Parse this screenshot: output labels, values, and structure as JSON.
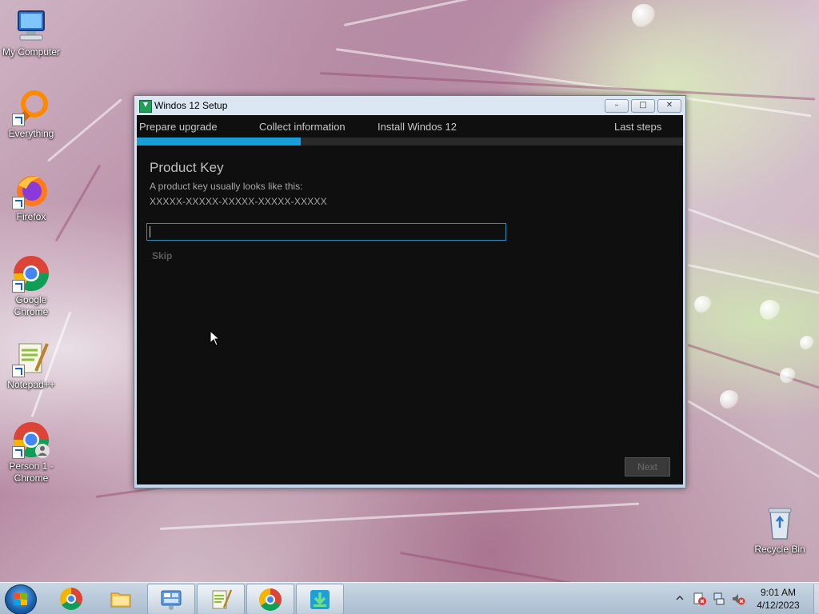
{
  "desktop": {
    "icons": [
      {
        "label": "My Computer",
        "icon": "computer-icon"
      },
      {
        "label": "Everything",
        "icon": "everything-icon"
      },
      {
        "label": "Firefox",
        "icon": "firefox-icon"
      },
      {
        "label": "Google Chrome",
        "icon": "chrome-icon"
      },
      {
        "label": "Notepad++",
        "icon": "notepadpp-icon"
      },
      {
        "label": "Person 1 - Chrome",
        "icon": "chrome-profile-icon"
      },
      {
        "label": "Recycle Bin",
        "icon": "recycle-bin-icon"
      }
    ]
  },
  "window": {
    "title": "Windos 12 Setup",
    "controls": {
      "minimize": "–",
      "restore": "□",
      "close": "✕"
    },
    "steps": [
      "Prepare upgrade",
      "Collect information",
      "Install Windos 12",
      "Last steps"
    ],
    "progress": 0.3,
    "heading": "Product Key",
    "description": "A product key usually looks like this:",
    "example_key": "XXXXX-XXXXX-XXXXX-XXXXX-XXXXX",
    "key_input": {
      "value": "",
      "placeholder": ""
    },
    "skip_label": "Skip",
    "next_label": "Next"
  },
  "taskbar": {
    "pinned": [
      "chrome-icon",
      "file-explorer-icon",
      "control-panel-icon",
      "notepadpp-icon",
      "chrome-icon",
      "setup-download-icon"
    ],
    "clock": {
      "time": "9:01 AM",
      "date": "4/12/2023"
    },
    "tray_icons": [
      "show-hidden-icons-chevron",
      "action-center-icon",
      "network-icon",
      "volume-muted-icon"
    ]
  },
  "colors": {
    "accent": "#169fd8",
    "window_bg": "#0f0f10",
    "input_border": "#2b8fbd"
  }
}
